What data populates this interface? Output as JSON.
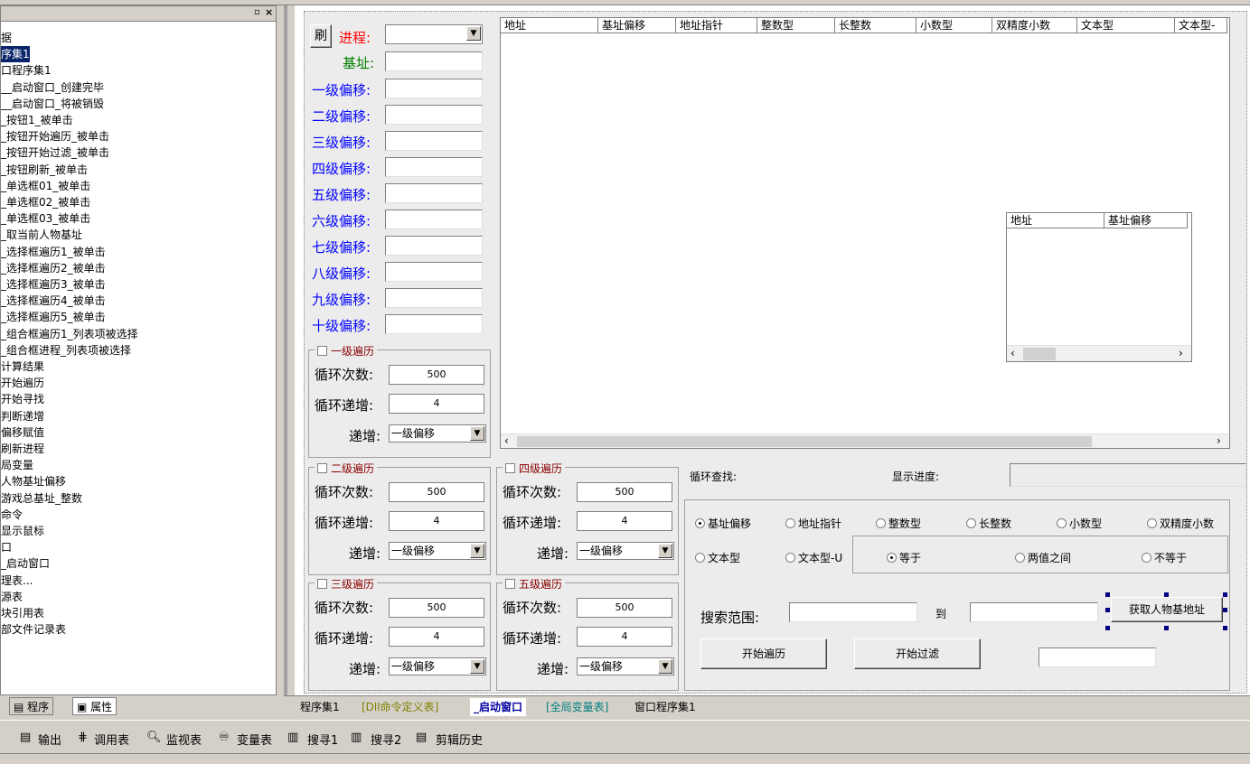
{
  "tree": {
    "items": [
      "据",
      "序集1",
      "口程序集1",
      "__启动窗口_创建完毕",
      "__启动窗口_将被销毁",
      "_按钮1_被单击",
      "_按钮开始遍历_被单击",
      "_按钮开始过滤_被单击",
      "_按钮刷新_被单击",
      "_单选框01_被单击",
      "_单选框02_被单击",
      "_单选框03_被单击",
      "_取当前人物基址",
      "_选择框遍历1_被单击",
      "_选择框遍历2_被单击",
      "_选择框遍历3_被单击",
      "_选择框遍历4_被单击",
      "_选择框遍历5_被单击",
      "_组合框遍历1_列表项被选择",
      "_组合框进程_列表项被选择",
      "计算结果",
      "开始遍历",
      "开始寻找",
      "判断递增",
      "偏移赋值",
      "刷新进程",
      "局变量",
      "人物基址偏移",
      "游戏总基址_整数",
      "命令",
      "显示鼠标",
      "口",
      "_启动窗口",
      "理表...",
      "源表",
      "块引用表",
      "部文件记录表"
    ],
    "selected_index": 1
  },
  "form": {
    "refresh_label": "刷",
    "process_label": "进程:",
    "base_label": "基址:",
    "offsets": [
      "一级偏移:",
      "二级偏移:",
      "三级偏移:",
      "四级偏移:",
      "五级偏移:",
      "六级偏移:",
      "七级偏移:",
      "八级偏移:",
      "九级偏移:",
      "十级偏移:"
    ],
    "loop_count_label": "循环次数:",
    "loop_inc_label": "循环递增:",
    "inc_label": "递增:",
    "groups": [
      {
        "title": "一级遍历",
        "count": "500",
        "inc": "4",
        "combo": "一级偏移"
      },
      {
        "title": "二级遍历",
        "count": "500",
        "inc": "4",
        "combo": "一级偏移"
      },
      {
        "title": "三级遍历",
        "count": "500",
        "inc": "4",
        "combo": "一级偏移"
      },
      {
        "title": "四级遍历",
        "count": "500",
        "inc": "4",
        "combo": "一级偏移"
      },
      {
        "title": "五级遍历",
        "count": "500",
        "inc": "4",
        "combo": "一级偏移"
      }
    ],
    "main_list_cols": [
      "地址",
      "基址偏移",
      "地址指针",
      "整数型",
      "长整数",
      "小数型",
      "双精度小数",
      "文本型",
      "文本型-"
    ],
    "small_list_cols": [
      "地址",
      "基址偏移"
    ],
    "loop_find_label": "循环查找:",
    "progress_label": "显示进度:",
    "radios_row1": [
      "基址偏移",
      "地址指针",
      "整数型",
      "长整数",
      "小数型",
      "双精度小数"
    ],
    "radios_row2": [
      "文本型",
      "文本型-U"
    ],
    "compare_radios": [
      "等于",
      "两值之间",
      "不等于"
    ],
    "search_range_label": "搜索范围:",
    "to_label": "到",
    "get_base_button": "获取人物基地址",
    "start_traverse_button": "开始遍历",
    "start_filter_button": "开始过滤"
  },
  "left_tabs": [
    "程序",
    "属性"
  ],
  "doc_tabs": [
    "程序集1",
    "[Dll命令定义表]",
    "_启动窗口",
    "[全局变量表]",
    "窗口程序集1"
  ],
  "bottom_tools": [
    "输出",
    "调用表",
    "监视表",
    "变量表",
    "搜寻1",
    "搜寻2",
    "剪辑历史"
  ]
}
